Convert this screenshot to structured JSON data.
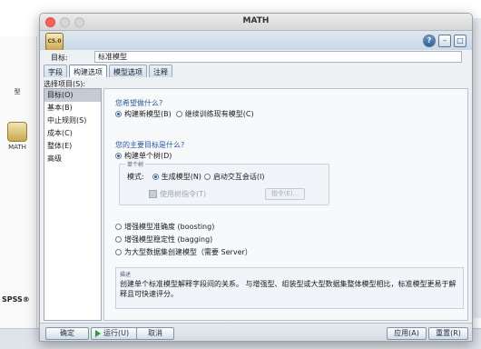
{
  "window": {
    "title": "MATH"
  },
  "background": {
    "left_nodes": [
      "型",
      "MATH"
    ],
    "spss_label": "SPSS®"
  },
  "node_icon_label": "C5.0",
  "target": {
    "label": "目标:",
    "value": "标准模型"
  },
  "tabs": [
    "字段",
    "构建选项",
    "模型选项",
    "注释"
  ],
  "select_items_label": "选择项目(S):",
  "list_items": [
    "目标(O)",
    "基本(B)",
    "中止规则(S)",
    "成本(C)",
    "整体(E)",
    "高级"
  ],
  "panel": {
    "q1": "您希望做什么?",
    "q1_opt1": "构建新模型(B)",
    "q1_opt2": "继续训练现有模型(C)",
    "q2": "您的主要目标是什么?",
    "q2_opt_single": "构建单个树(D)",
    "group_caption": "单个树",
    "mode_label": "模式:",
    "mode_opt1": "生成模型(N)",
    "mode_opt2": "启动交互会话(I)",
    "use_tree_directive": "使用树指令(T)",
    "directive_button": "指令(E)...",
    "opt_boosting": "增强模型准确度 (boosting)",
    "opt_bagging": "增强模型稳定性 (bagging)",
    "opt_server": "为大型数据集创建模型（需要 Server）",
    "desc_caption": "描述",
    "desc_text": "创建单个标准模型解释字段间的关系。 与增强型、组装型或大型数据集整体模型相比，标准模型更易于解释且可快速评分。"
  },
  "buttons": {
    "ok": "确定",
    "run": "运行(U)",
    "cancel": "取消",
    "apply": "应用(A)",
    "reset": "重置(R)"
  }
}
